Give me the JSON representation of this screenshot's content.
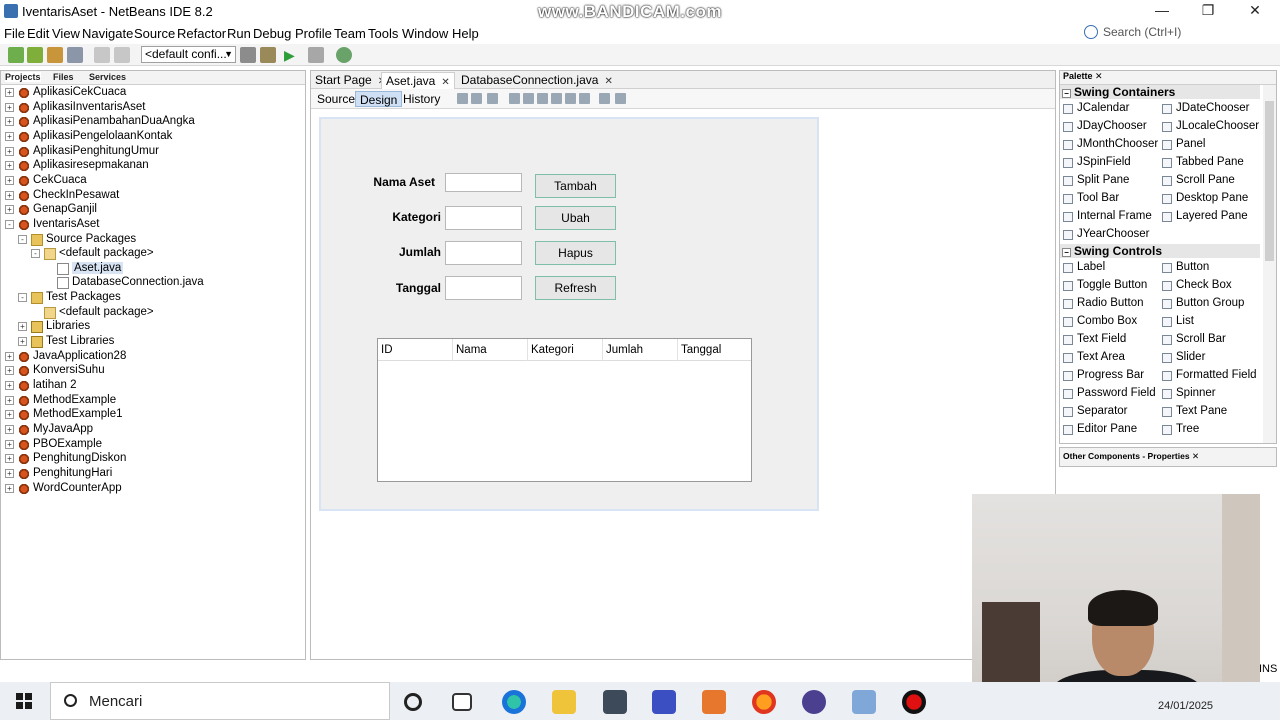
{
  "window": {
    "title": "IventarisAset - NetBeans IDE 8.2",
    "watermark": "www.BANDICAM.com",
    "minimize": "—",
    "maximize": "❐",
    "close": "✕"
  },
  "menu": [
    "File",
    "Edit",
    "View",
    "Navigate",
    "Source",
    "Refactor",
    "Run",
    "Debug",
    "Profile",
    "Team",
    "Tools",
    "Window",
    "Help"
  ],
  "search": {
    "placeholder": "Search (Ctrl+I)"
  },
  "toolbar": {
    "config": "<default confi..."
  },
  "left_panel": {
    "tabs": [
      "Projects",
      "Files",
      "Services"
    ],
    "tree": [
      {
        "label": "AplikasiCekCuaca",
        "level": 0,
        "icon": "project-icon",
        "toggle": "+"
      },
      {
        "label": "AplikasiInventarisAset",
        "level": 0,
        "icon": "project-icon",
        "toggle": "+"
      },
      {
        "label": "AplikasiPenambahanDuaAngka",
        "level": 0,
        "icon": "project-icon",
        "toggle": "+"
      },
      {
        "label": "AplikasiPengelolaanKontak",
        "level": 0,
        "icon": "project-icon",
        "toggle": "+"
      },
      {
        "label": "AplikasiPenghitungUmur",
        "level": 0,
        "icon": "project-icon",
        "toggle": "+"
      },
      {
        "label": "Aplikasiresepmakanan",
        "level": 0,
        "icon": "project-icon",
        "toggle": "+"
      },
      {
        "label": "CekCuaca",
        "level": 0,
        "icon": "project-icon",
        "toggle": "+"
      },
      {
        "label": "CheckInPesawat",
        "level": 0,
        "icon": "project-icon",
        "toggle": "+"
      },
      {
        "label": "GenapGanjil",
        "level": 0,
        "icon": "project-icon",
        "toggle": "+"
      },
      {
        "label": "IventarisAset",
        "level": 0,
        "icon": "project-icon",
        "toggle": "-"
      },
      {
        "label": "Source Packages",
        "level": 1,
        "icon": "package-folder-icon",
        "toggle": "-"
      },
      {
        "label": "<default package>",
        "level": 2,
        "icon": "package-icon",
        "toggle": "-"
      },
      {
        "label": "Aset.java",
        "level": 3,
        "icon": "java-file-icon",
        "toggle": "",
        "selected": true
      },
      {
        "label": "DatabaseConnection.java",
        "level": 3,
        "icon": "java-file-icon",
        "toggle": ""
      },
      {
        "label": "Test Packages",
        "level": 1,
        "icon": "package-folder-icon",
        "toggle": "-"
      },
      {
        "label": "<default package>",
        "level": 2,
        "icon": "package-icon",
        "toggle": ""
      },
      {
        "label": "Libraries",
        "level": 1,
        "icon": "library-icon",
        "toggle": "+"
      },
      {
        "label": "Test Libraries",
        "level": 1,
        "icon": "library-icon",
        "toggle": "+"
      },
      {
        "label": "JavaApplication28",
        "level": 0,
        "icon": "project-icon",
        "toggle": "+"
      },
      {
        "label": "KonversiSuhu",
        "level": 0,
        "icon": "project-icon",
        "toggle": "+"
      },
      {
        "label": "latihan 2",
        "level": 0,
        "icon": "project-icon",
        "toggle": "+"
      },
      {
        "label": "MethodExample",
        "level": 0,
        "icon": "project-icon",
        "toggle": "+"
      },
      {
        "label": "MethodExample1",
        "level": 0,
        "icon": "project-icon",
        "toggle": "+"
      },
      {
        "label": "MyJavaApp",
        "level": 0,
        "icon": "project-icon",
        "toggle": "+"
      },
      {
        "label": "PBOExample",
        "level": 0,
        "icon": "project-icon",
        "toggle": "+"
      },
      {
        "label": "PenghitungDiskon",
        "level": 0,
        "icon": "project-icon",
        "toggle": "+"
      },
      {
        "label": "PenghitungHari",
        "level": 0,
        "icon": "project-icon",
        "toggle": "+"
      },
      {
        "label": "WordCounterApp",
        "level": 0,
        "icon": "project-icon",
        "toggle": "+"
      }
    ]
  },
  "editor": {
    "tabs": [
      {
        "label": "Start Page"
      },
      {
        "label": "Aset.java"
      },
      {
        "label": "DatabaseConnection.java"
      }
    ],
    "views": [
      "Source",
      "Design",
      "History"
    ]
  },
  "form": {
    "labels": [
      "Nama Aset",
      "Kategori",
      "Jumlah",
      "Tanggal"
    ],
    "buttons": [
      "Tambah",
      "Ubah",
      "Hapus",
      "Refresh"
    ],
    "columns": [
      "ID",
      "Nama",
      "Kategori",
      "Jumlah",
      "Tanggal"
    ]
  },
  "palette": {
    "tab": "Palette",
    "swing_containers": "Swing Containers",
    "container_items": [
      "JCalendar",
      "JDateChooser",
      "JDayChooser",
      "JLocaleChooser",
      "JMonthChooser",
      "Panel",
      "JSpinField",
      "Tabbed Pane",
      "Split Pane",
      "Scroll Pane",
      "Tool Bar",
      "Desktop Pane",
      "Internal Frame",
      "Layered Pane",
      "JYearChooser"
    ],
    "swing_controls": "Swing Controls",
    "control_items": [
      "Label",
      "Button",
      "Toggle Button",
      "Check Box",
      "Radio Button",
      "Button Group",
      "Combo Box",
      "List",
      "Text Field",
      "Scroll Bar",
      "Text Area",
      "Slider",
      "Progress Bar",
      "Formatted Field",
      "Password Field",
      "Spinner",
      "Separator",
      "Text Pane",
      "Editor Pane",
      "Tree"
    ]
  },
  "properties": {
    "title": "Other Components - Properties"
  },
  "status": {
    "ins": "INS"
  },
  "taskbar": {
    "search_placeholder": "Mencari",
    "date": "24/01/2025"
  }
}
